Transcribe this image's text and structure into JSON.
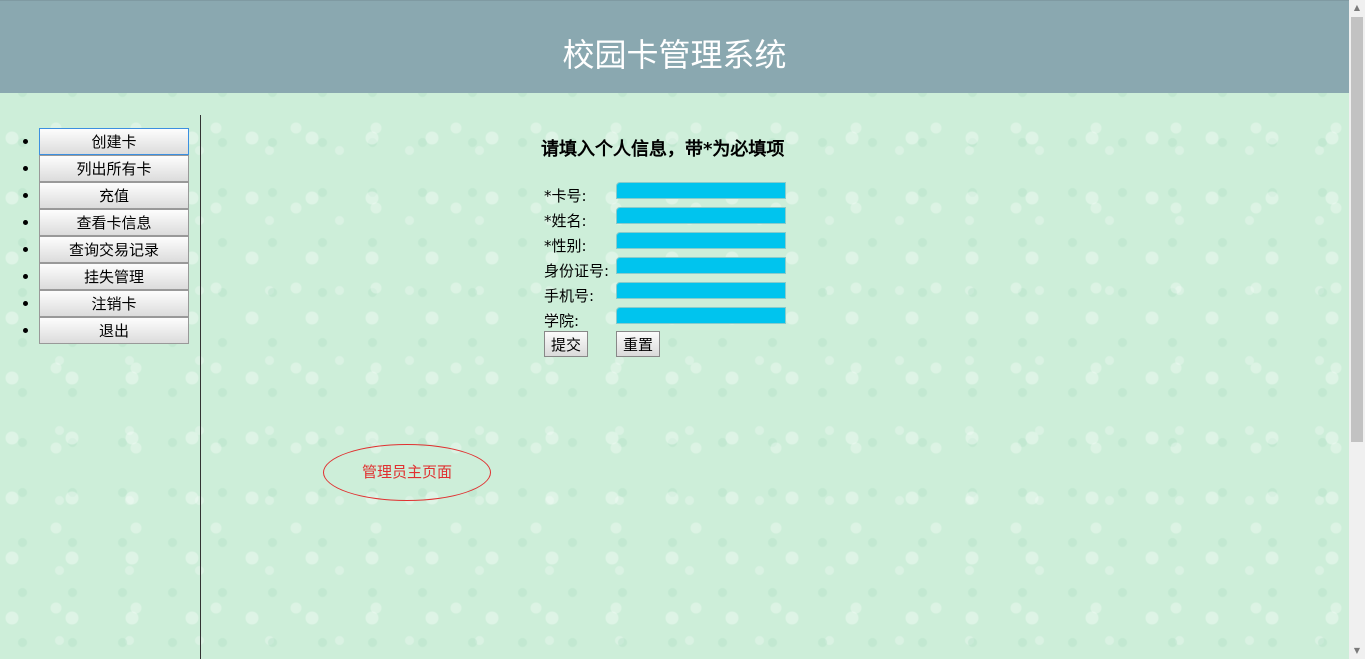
{
  "header": {
    "title": "校园卡管理系统"
  },
  "sidebar": {
    "items": [
      {
        "label": "创建卡",
        "active": true
      },
      {
        "label": "列出所有卡"
      },
      {
        "label": "充值"
      },
      {
        "label": "查看卡信息"
      },
      {
        "label": "查询交易记录"
      },
      {
        "label": "挂失管理"
      },
      {
        "label": "注销卡"
      },
      {
        "label": "退出"
      }
    ]
  },
  "form": {
    "heading": "请填入个人信息，带*为必填项",
    "fields": [
      {
        "label": "*卡号:",
        "value": ""
      },
      {
        "label": "*姓名:",
        "value": ""
      },
      {
        "label": "*性别:",
        "value": ""
      },
      {
        "label": "身份证号:",
        "value": ""
      },
      {
        "label": "手机号:",
        "value": ""
      },
      {
        "label": "学院:",
        "value": ""
      }
    ],
    "submit_label": "提交",
    "reset_label": "重置"
  },
  "annotation": {
    "text": "管理员主页面"
  },
  "colors": {
    "header_bg": "#8aa8b0",
    "input_bg": "#00c4ee",
    "annotation": "#e03030",
    "active_border": "#3c8fe0"
  },
  "icons": {
    "scroll_up": "scroll-up-arrow-icon",
    "scroll_down": "scroll-down-arrow-icon",
    "bullet": "bullet-dot-icon"
  }
}
